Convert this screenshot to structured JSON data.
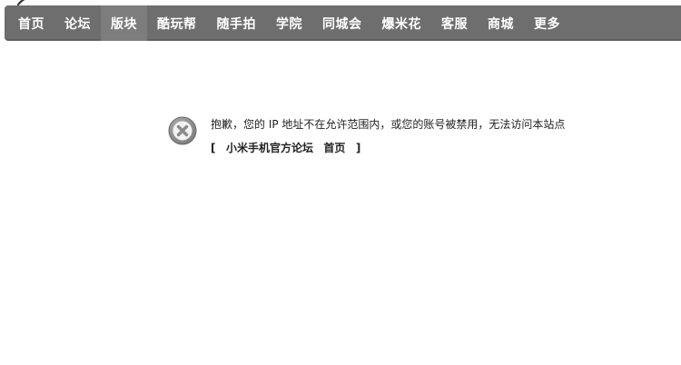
{
  "nav": {
    "items": [
      {
        "label": "首页",
        "active": false
      },
      {
        "label": "论坛",
        "active": false
      },
      {
        "label": "版块",
        "active": true
      },
      {
        "label": "酷玩帮",
        "active": false
      },
      {
        "label": "随手拍",
        "active": false
      },
      {
        "label": "学院",
        "active": false
      },
      {
        "label": "同城会",
        "active": false
      },
      {
        "label": "爆米花",
        "active": false
      },
      {
        "label": "客服",
        "active": false
      },
      {
        "label": "商城",
        "active": false
      },
      {
        "label": "更多",
        "active": false
      }
    ]
  },
  "message": {
    "icon": "error-x-circle-icon",
    "text": "抱歉，您的 IP 地址不在允许范围内，或您的账号被禁用，无法访问本站点",
    "open_bracket": "[",
    "close_bracket": "]",
    "link_forum": "小米手机官方论坛",
    "link_home": "首页"
  },
  "colors": {
    "navbar_bg": "#6e6e6e",
    "navbar_active_bg": "#7d7d7d",
    "nav_text": "#ffffff",
    "icon_gray": "#8a8a8a"
  }
}
